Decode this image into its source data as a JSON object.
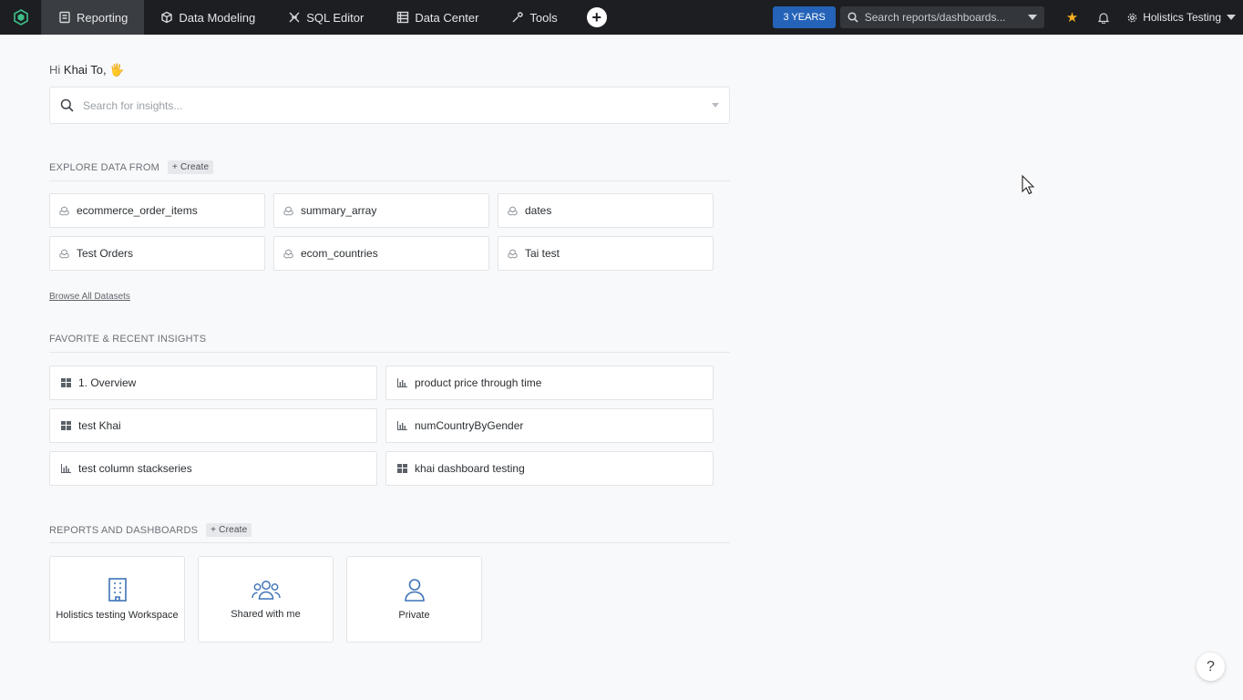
{
  "nav": {
    "items": [
      {
        "label": "Reporting",
        "icon": "reporting-icon",
        "active": true
      },
      {
        "label": "Data Modeling",
        "icon": "cube-icon"
      },
      {
        "label": "SQL Editor",
        "icon": "sql-icon"
      },
      {
        "label": "Data Center",
        "icon": "list-icon"
      },
      {
        "label": "Tools",
        "icon": "wrench-icon"
      }
    ],
    "plus_icon": "plus-icon",
    "years_label": "3 YEARS",
    "search_placeholder": "Search reports/dashboards...",
    "workspace_label": "Holistics Testing",
    "accent_color": "#2563b8"
  },
  "greeting": {
    "prefix": "Hi",
    "name": "Khai To,",
    "emoji": "🖐"
  },
  "insight_search": {
    "placeholder": "Search for insights..."
  },
  "explore": {
    "title": "EXPLORE DATA FROM",
    "create_label": "+ Create",
    "datasets": [
      "ecommerce_order_items",
      "summary_array",
      "dates",
      "Test Orders",
      "ecom_countries",
      "Tai test"
    ],
    "browse_label": "Browse All Datasets"
  },
  "favorites": {
    "title": "FAVORITE & RECENT INSIGHTS",
    "items": [
      {
        "label": "1. Overview",
        "icon": "dashboard-icon"
      },
      {
        "label": "product price through time",
        "icon": "chart-icon"
      },
      {
        "label": "test Khai",
        "icon": "dashboard-icon"
      },
      {
        "label": "numCountryByGender",
        "icon": "chart-icon"
      },
      {
        "label": "test column stackseries",
        "icon": "chart-icon"
      },
      {
        "label": "khai dashboard testing",
        "icon": "dashboard-icon"
      }
    ]
  },
  "reports": {
    "title": "REPORTS AND DASHBOARDS",
    "create_label": "+ Create",
    "folders": [
      {
        "label": "Holistics testing Workspace",
        "icon": "building-icon"
      },
      {
        "label": "Shared with me",
        "icon": "users-icon"
      },
      {
        "label": "Private",
        "icon": "user-icon"
      }
    ]
  },
  "help_label": "?"
}
